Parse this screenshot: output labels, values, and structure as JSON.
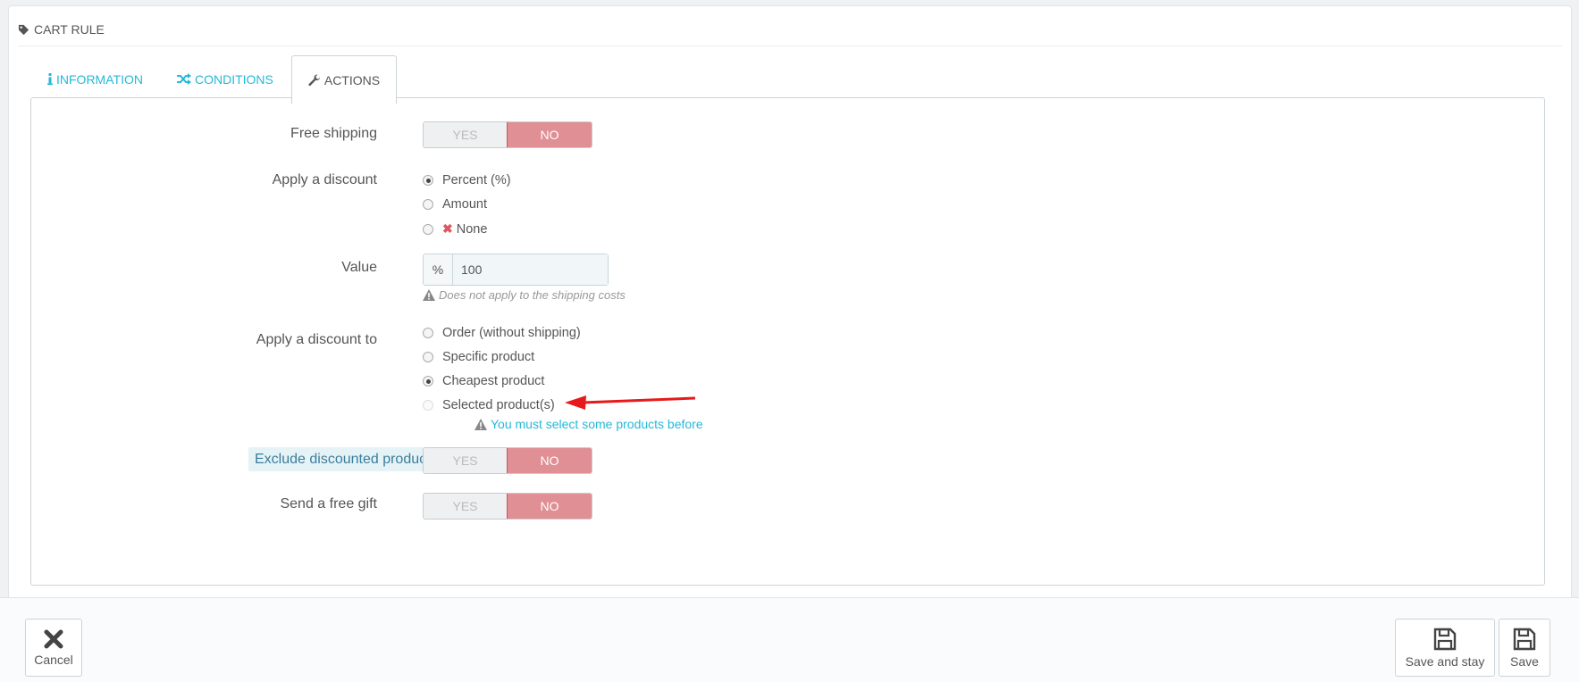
{
  "panel": {
    "title": "CART RULE",
    "icon": "tag-icon"
  },
  "tabs": [
    {
      "label": "INFORMATION",
      "icon": "info-icon",
      "active": false
    },
    {
      "label": "CONDITIONS",
      "icon": "shuffle-icon",
      "active": false
    },
    {
      "label": "ACTIONS",
      "icon": "wrench-icon",
      "active": true
    }
  ],
  "form": {
    "free_shipping": {
      "label": "Free shipping",
      "yes": "YES",
      "no": "NO",
      "value": "NO"
    },
    "apply_discount": {
      "label": "Apply a discount",
      "options": [
        "Percent (%)",
        "Amount",
        "None"
      ],
      "selected": "Percent (%)"
    },
    "value": {
      "label": "Value",
      "addon": "%",
      "value": "100",
      "help": "Does not apply to the shipping costs"
    },
    "apply_discount_to": {
      "label": "Apply a discount to",
      "options": [
        "Order (without shipping)",
        "Specific product",
        "Cheapest product",
        "Selected product(s)"
      ],
      "selected": "Cheapest product",
      "warning": "You must select some products before"
    },
    "exclude_discounted": {
      "label": "Exclude discounted products",
      "yes": "YES",
      "no": "NO",
      "value": "NO"
    },
    "free_gift": {
      "label": "Send a free gift",
      "yes": "YES",
      "no": "NO",
      "value": "NO"
    }
  },
  "footer": {
    "cancel": "Cancel",
    "save_and_stay": "Save and stay",
    "save": "Save"
  },
  "colors": {
    "accent": "#25b9d7",
    "no_active": "#e08f95",
    "arrow": "#e8191b"
  }
}
